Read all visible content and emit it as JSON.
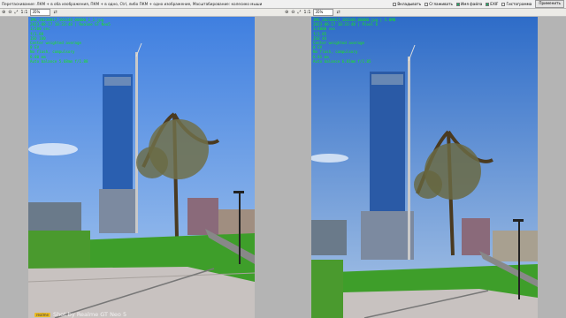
{
  "topbar": {
    "hint": "Перетаскивание: ЛКМ + в оба изображения, ПКМ + в одно, Ctrl, либо ПКМ + одно изображение, Масштабирование: колесико мыши",
    "checkboxes": [
      {
        "label": "Вкладывать",
        "checked": false
      },
      {
        "label": "Сглаживать",
        "checked": false
      },
      {
        "label": "Имя файла",
        "checked": true
      },
      {
        "label": "EXIF",
        "checked": true
      },
      {
        "label": "Гистограмма",
        "checked": false
      }
    ],
    "apply_button": "Применить"
  },
  "left": {
    "title_icons": [
      "zoom-in",
      "zoom-out",
      "fit",
      "1:1"
    ],
    "zoom": "35%",
    "fit_label": "1:1",
    "exif_lines": [
      "IMG_20230817_103348_00000_1_1.jpg",
      "2023-08-17 10:33:48 | Realme GT Neo5",
      "1/500 sec",
      "f/1.88",
      "ISO 100",
      "Center weighted average",
      "0 EV",
      "No flash, compulsory",
      "6.00 mm",
      "Auto balance 5.68mm f/1.88"
    ],
    "watermark_tag": "realme",
    "watermark_text": "Shot by Realme GT Neo 5",
    "colors": {
      "sky_top": "#3f7fe0",
      "sky_bottom": "#a8c8ee"
    }
  },
  "right": {
    "title_icons": [
      "zoom-in",
      "zoom-out",
      "fit",
      "1:1"
    ],
    "zoom": "35%",
    "fit_label": "1:1",
    "exif_lines": [
      "IMG_20230817_103348_00000.jpg | 5.0MB",
      "2023-08-17 10:33:48 | Pixel 6",
      "1/4000 sec",
      "f/1.85",
      "ISO 44",
      "Center weighted average",
      "0 EV",
      "No flash, compulsory",
      "6.81 mm",
      "Auto balance 6.81mm f/1.85"
    ],
    "colors": {
      "sky_top": "#2e6cc8",
      "sky_bottom": "#a8c4e6"
    }
  }
}
